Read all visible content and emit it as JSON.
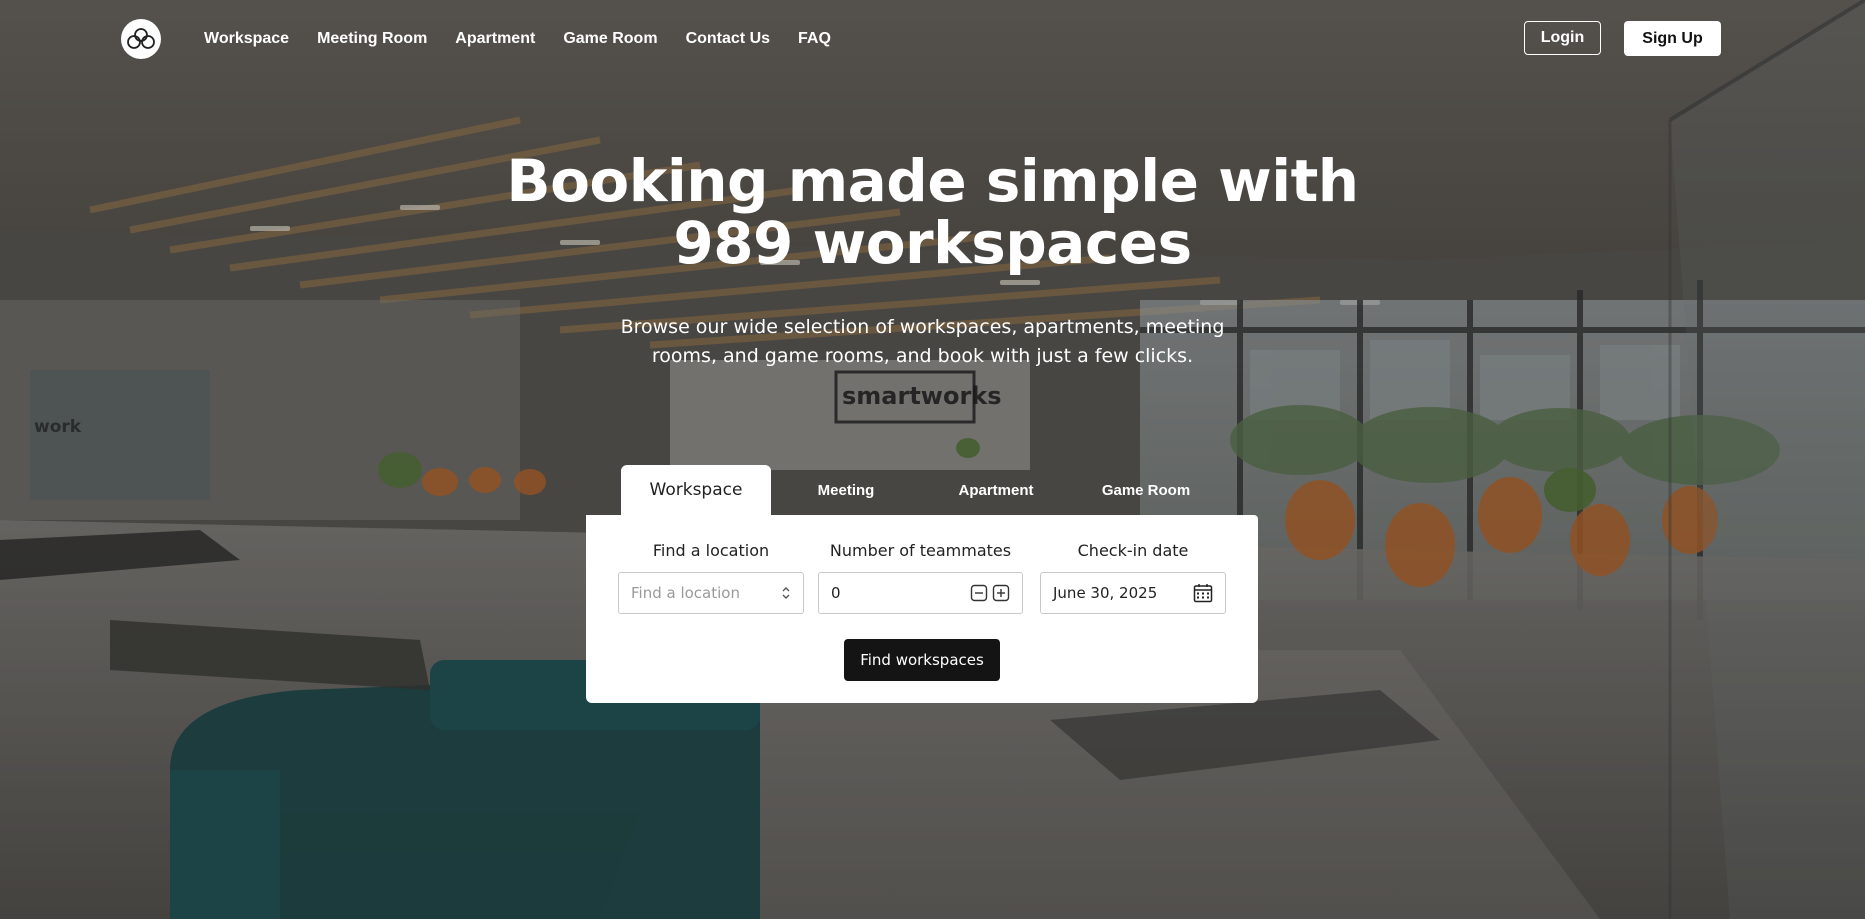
{
  "nav": {
    "links": [
      "Workspace",
      "Meeting Room",
      "Apartment",
      "Game Room",
      "Contact Us",
      "FAQ"
    ],
    "login_label": "Login",
    "signup_label": "Sign Up"
  },
  "hero": {
    "headline_line1": "Booking made simple with",
    "headline_line2": "989 workspaces",
    "subtext_line1": "Browse our wide selection of workspaces, apartments, meeting",
    "subtext_line2": "rooms, and game rooms, and book with just a few clicks.",
    "background_sign": "smartworks",
    "background_wall_text": "work"
  },
  "search": {
    "tabs": [
      "Workspace",
      "Meeting",
      "Apartment",
      "Game Room"
    ],
    "active_tab": "Workspace",
    "location_label": "Find a location",
    "location_placeholder": "Find a location",
    "teammates_label": "Number of teammates",
    "teammates_value": "0",
    "date_label": "Check-in date",
    "date_value": "June 30, 2025",
    "submit_label": "Find workspaces"
  },
  "colors": {
    "button_dark": "#141414",
    "card_bg": "#ffffff",
    "text_light": "#ffffff"
  },
  "icons": [
    "logo-icon",
    "chevron-updown-icon",
    "minus-icon",
    "plus-icon",
    "calendar-icon"
  ]
}
